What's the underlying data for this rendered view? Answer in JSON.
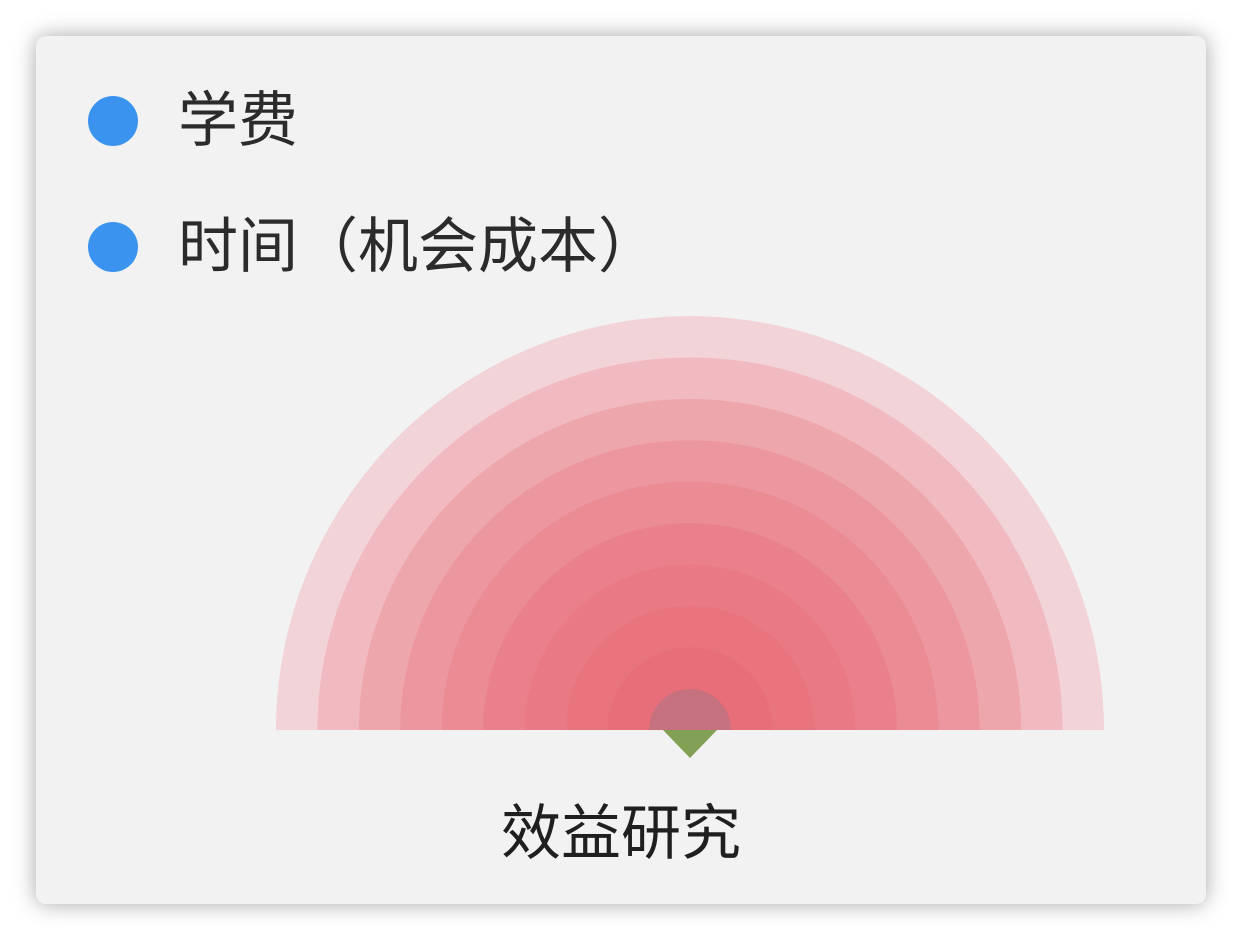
{
  "legend": [
    {
      "label": "学费",
      "color": "#3a93ef"
    },
    {
      "label": "时间（机会成本）",
      "color": "#3a93ef"
    }
  ],
  "fan": {
    "ring_colors": [
      "#f2d3d7",
      "#f1bac0",
      "#eea6ad",
      "#ec979f",
      "#eb8b94",
      "#ea818a",
      "#e97a84",
      "#e8747e",
      "#e86f79",
      "#e86a74"
    ],
    "hub_color": "#c6717f",
    "pointer_color": "#83a155"
  },
  "caption": "效益研究"
}
